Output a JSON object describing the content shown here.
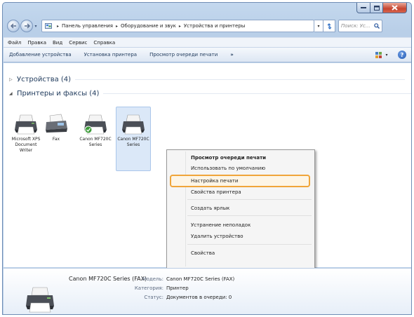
{
  "window": {
    "search_placeholder": "Поиск: Ус...",
    "breadcrumbs": [
      "Панель управления",
      "Оборудование и звук",
      "Устройства и принтеры"
    ]
  },
  "menubar": {
    "items": [
      "Файл",
      "Правка",
      "Вид",
      "Сервис",
      "Справка"
    ]
  },
  "cmdbar": {
    "items": [
      "Добавление устройства",
      "Установка принтера",
      "Просмотр очереди печати"
    ],
    "more": "»"
  },
  "groups": {
    "devices": "Устройства (4)",
    "printers": "Принтеры и факсы (4)"
  },
  "printers": [
    {
      "label": "Microsoft XPS Document Writer"
    },
    {
      "label": "Fax"
    },
    {
      "label": "Canon MF720C Series"
    },
    {
      "label": "Canon MF720C Series"
    }
  ],
  "context_menu": {
    "items": [
      {
        "label": "Просмотр очереди печати",
        "bold": true
      },
      {
        "label": "Использовать по умолчанию",
        "bold": false
      },
      {
        "label": "Настройка печати",
        "bold": false,
        "highlighted": true
      },
      {
        "label": "Свойства принтера",
        "bold": false
      },
      {
        "label": "Создать ярлык",
        "bold": false
      },
      {
        "label": "Устранение неполадок",
        "bold": false
      },
      {
        "label": "Удалить устройство",
        "bold": false
      },
      {
        "label": "Свойства",
        "bold": false
      }
    ]
  },
  "details": {
    "name": "Canon MF720C Series (FAX)",
    "model_label": "Модель:",
    "model_value": "Canon MF720C Series (FAX)",
    "category_label": "Категория:",
    "category_value": "Принтер",
    "status_label": "Статус:",
    "status_value": "Документов в очереди: 0"
  },
  "colors": {
    "highlight_border": "#f0a53a",
    "accent": "#1e395b"
  }
}
